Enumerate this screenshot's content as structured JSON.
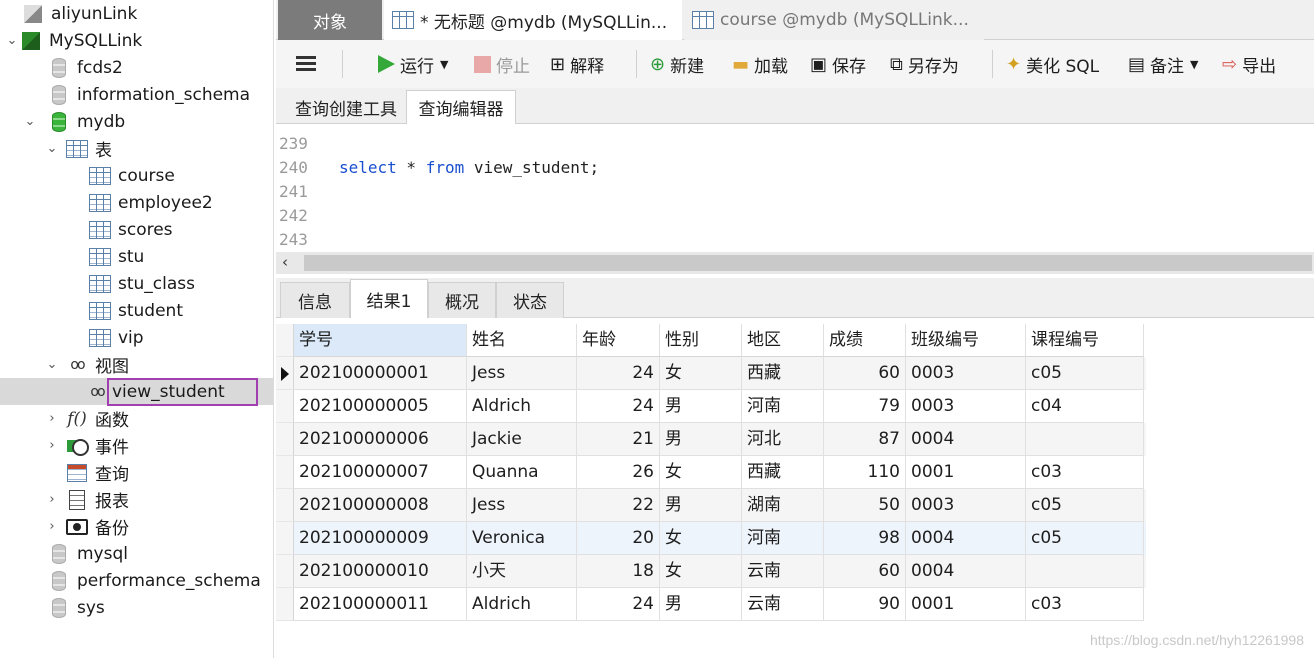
{
  "sidebar": {
    "items": [
      {
        "label": "aliyunLink"
      },
      {
        "label": "MySQLLink"
      },
      {
        "label": "fcds2"
      },
      {
        "label": "information_schema"
      },
      {
        "label": "mydb"
      },
      {
        "label": "表"
      },
      {
        "label": "course"
      },
      {
        "label": "employee2"
      },
      {
        "label": "scores"
      },
      {
        "label": "stu"
      },
      {
        "label": "stu_class"
      },
      {
        "label": "student"
      },
      {
        "label": "vip"
      },
      {
        "label": "视图"
      },
      {
        "label": "view_student"
      },
      {
        "label": "函数"
      },
      {
        "label": "事件"
      },
      {
        "label": "查询"
      },
      {
        "label": "报表"
      },
      {
        "label": "备份"
      },
      {
        "label": "mysql"
      },
      {
        "label": "performance_schema"
      },
      {
        "label": "sys"
      }
    ]
  },
  "tabs": {
    "objects": "对象",
    "active": "* 无标题 @mydb (MySQLLin...",
    "inactive": "course @mydb (MySQLLink..."
  },
  "toolbar": {
    "run": "运行",
    "stop": "停止",
    "explain": "解释",
    "new": "新建",
    "load": "加载",
    "save": "保存",
    "save_as": "另存为",
    "beautify": "美化 SQL",
    "comment": "备注",
    "export": "导出"
  },
  "subtabs": {
    "builder": "查询创建工具",
    "editor": "查询编辑器"
  },
  "editor": {
    "lines": [
      {
        "num": "239",
        "code": ""
      },
      {
        "num": "240",
        "kw1": "select",
        "mid": " * ",
        "kw2": "from",
        "rest": " view_student;"
      },
      {
        "num": "241",
        "code": ""
      },
      {
        "num": "242",
        "code": ""
      },
      {
        "num": "243",
        "code": ""
      }
    ]
  },
  "result_tabs": {
    "info": "信息",
    "result1": "结果1",
    "profile": "概况",
    "status": "状态"
  },
  "grid": {
    "columns": [
      "学号",
      "姓名",
      "年龄",
      "性别",
      "地区",
      "成绩",
      "班级编号",
      "课程编号"
    ],
    "rows": [
      [
        "202100000001",
        "Jess",
        "24",
        "女",
        "西藏",
        "60",
        "0003",
        "c05"
      ],
      [
        "202100000005",
        "Aldrich",
        "24",
        "男",
        "河南",
        "79",
        "0003",
        "c04"
      ],
      [
        "202100000006",
        "Jackie",
        "21",
        "男",
        "河北",
        "87",
        "0004",
        ""
      ],
      [
        "202100000007",
        "Quanna",
        "26",
        "女",
        "西藏",
        "110",
        "0001",
        "c03"
      ],
      [
        "202100000008",
        "Jess",
        "22",
        "男",
        "湖南",
        "50",
        "0003",
        "c05"
      ],
      [
        "202100000009",
        "Veronica",
        "20",
        "女",
        "河南",
        "98",
        "0004",
        "c05"
      ],
      [
        "202100000010",
        "小天",
        "18",
        "女",
        "云南",
        "60",
        "0004",
        ""
      ],
      [
        "202100000011",
        "Aldrich",
        "24",
        "男",
        "云南",
        "90",
        "0001",
        "c03"
      ]
    ]
  },
  "watermark": "https://blog.csdn.net/hyh12261998"
}
